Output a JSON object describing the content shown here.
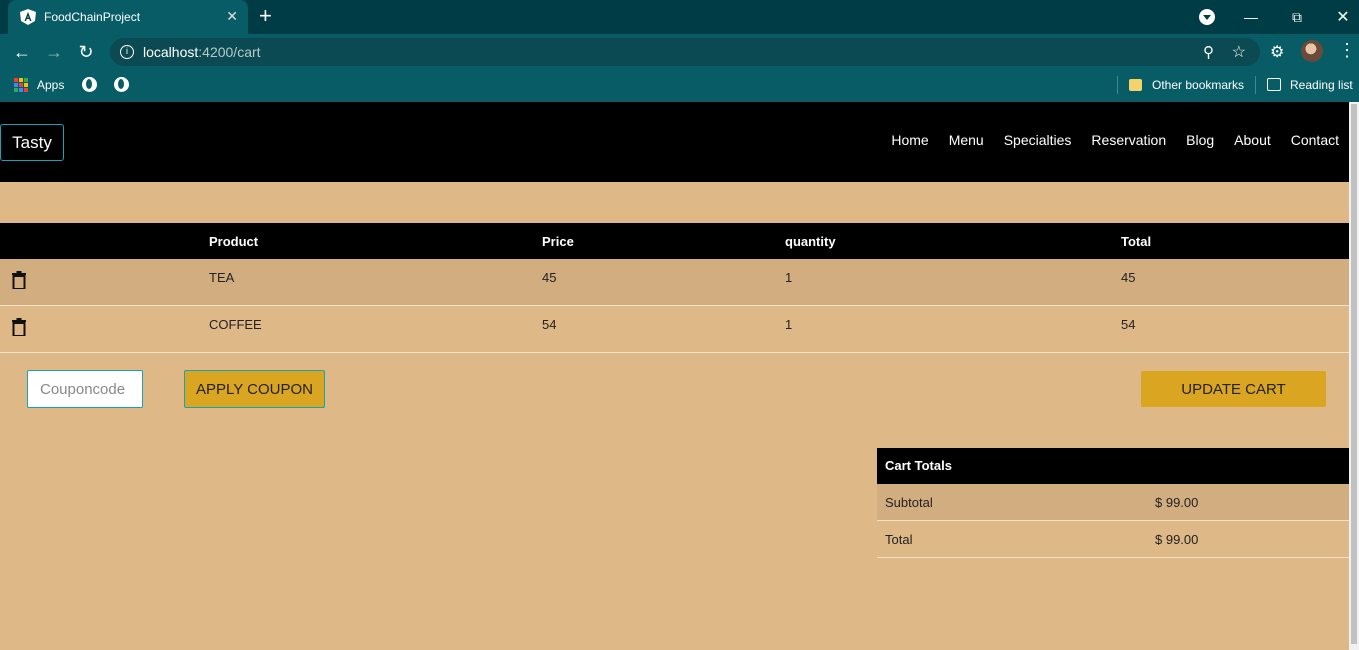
{
  "browser": {
    "tab_title": "FoodChainProject",
    "tab_close": "✕",
    "new_tab": "+",
    "url_host": "localhost",
    "url_path": ":4200/cart",
    "bookmarks": {
      "apps": "Apps",
      "other": "Other bookmarks",
      "reading_list": "Reading list"
    }
  },
  "navbar": {
    "brand": "Tasty",
    "links": [
      "Home",
      "Menu",
      "Specialties",
      "Reservation",
      "Blog",
      "About",
      "Contact"
    ]
  },
  "cart": {
    "headers": {
      "product": "Product",
      "price": "Price",
      "quantity": "quantity",
      "total": "Total"
    },
    "rows": [
      {
        "product": "TEA",
        "price": "45",
        "quantity": "1",
        "total": "45"
      },
      {
        "product": "COFFEE",
        "price": "54",
        "quantity": "1",
        "total": "54"
      }
    ]
  },
  "coupon": {
    "placeholder": "Couponcode",
    "apply_label": "APPLY COUPON",
    "update_label": "UPDATE CART"
  },
  "totals": {
    "title": "Cart Totals",
    "subtotal_label": "Subtotal",
    "subtotal_value": "$ 99.00",
    "total_label": "Total",
    "total_value": "$ 99.00"
  },
  "colors": {
    "page_bg": "#deb887",
    "accent_button": "#daa520",
    "accent_border": "#17a2b8",
    "header_bg": "#000000",
    "row_alt": "#d2ad80"
  }
}
